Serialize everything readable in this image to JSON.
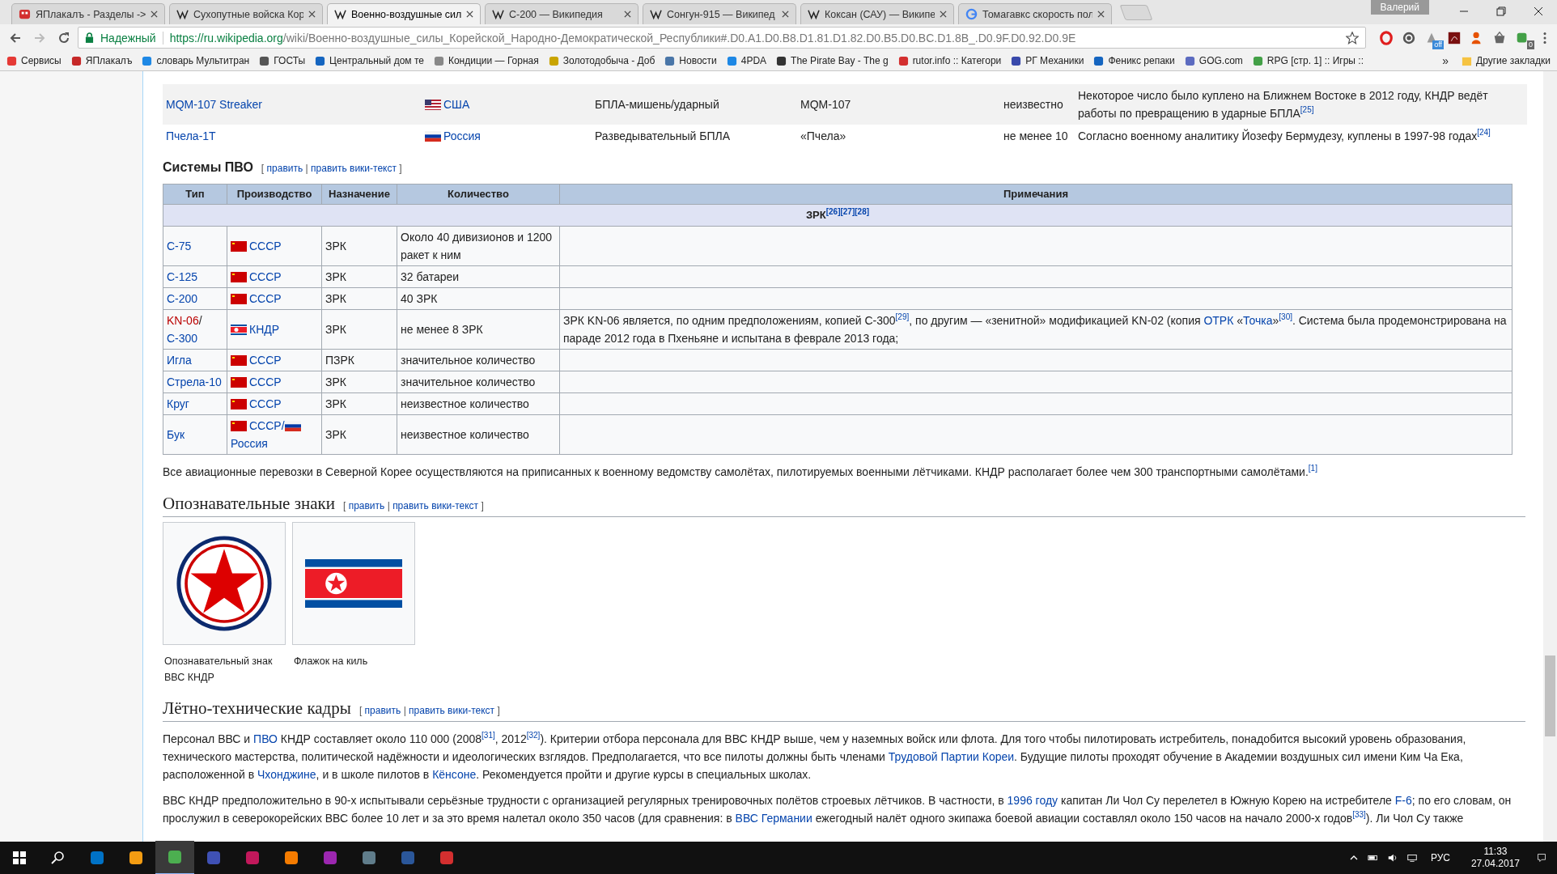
{
  "browser": {
    "tabs": [
      {
        "kind": "yaplakal",
        "title": "ЯПлакалъ - Разделы ->",
        "selected": false
      },
      {
        "kind": "wiki",
        "title": "Сухопутные войска Кор",
        "selected": false
      },
      {
        "kind": "wiki",
        "title": "Военно-воздушные сил",
        "selected": true
      },
      {
        "kind": "wiki",
        "title": "С-200 — Википедия",
        "selected": false
      },
      {
        "kind": "wiki",
        "title": "Сонгун-915 — Википед",
        "selected": false
      },
      {
        "kind": "wiki",
        "title": "Коксан (САУ) — Википе",
        "selected": false
      },
      {
        "kind": "google",
        "title": "Томагавкс скорость пол",
        "selected": false
      }
    ],
    "profile": "Валерий",
    "secure_label": "Надежный",
    "url_host": "https://ru.wikipedia.org",
    "url_path": "/wiki/Военно-воздушные_силы_Корейской_Народно-Демократической_Республики#.D0.A1.D0.B8.D1.81.D1.82.D0.B5.D0.BC.D1.8B_.D0.9F.D0.92.D0.9E",
    "extension_badges": [
      {
        "badge": "off"
      },
      {
        "badge": "0"
      }
    ],
    "bookmarks": [
      "Сервисы",
      "ЯПлакалъ",
      "словарь Мультитран",
      "ГОСТы",
      "Центральный дом те",
      "Кондиции — Горная",
      "Золотодобыча - Доб",
      "Новости",
      "4PDA",
      "The Pirate Bay - The g",
      "rutor.info :: Категори",
      "РГ Механики",
      "Феникс репаки",
      "GOG.com",
      "RPG [стр. 1] :: Игры ::"
    ],
    "bookmarks_overflow": "»",
    "other_bookmarks": "Другие закладки"
  },
  "prev_table": {
    "rows": [
      {
        "highlighted": true,
        "name": "MQM-107 Streaker",
        "origin": [
          {
            "kind": "usa-flag"
          },
          {
            "kind": "link",
            "text": "США"
          }
        ],
        "purpose": "БПЛА-мишень/ударный",
        "model": "MQM-107",
        "count": "неизвестно",
        "note": "Некоторое число было куплено на Ближнем Востоке в 2012 году, КНДР ведёт работы по превращению в ударные БПЛА$^{[25]}$"
      },
      {
        "highlighted": false,
        "name": "Пчела-1Т",
        "origin": [
          {
            "kind": "russia-flag"
          },
          {
            "kind": "link",
            "text": "Россия"
          }
        ],
        "purpose": "Разведывательный БПЛА",
        "model": "«Пчела»",
        "count": "не менее 10",
        "note": "Согласно военному аналитику Йозефу Бермудезу, куплены в 1997-98 годах$^{[24]}$"
      }
    ]
  },
  "pvo": {
    "heading": "Системы ПВО",
    "edit": {
      "open": "[",
      "links": [
        "править",
        "править вики-текст"
      ],
      "separator": "|",
      "close": "]"
    },
    "columns": [
      "Тип",
      "Производство",
      "Назначение",
      "Количество",
      "Примечания"
    ],
    "group": "ЗРК$^{[26][27][28]}$",
    "rows": [
      {
        "type": [
          {
            "kind": "link",
            "text": "С-75"
          }
        ],
        "origin": [
          {
            "kind": "ussr-flag"
          },
          {
            "kind": "link",
            "text": "СССР"
          }
        ],
        "purpose": "ЗРК",
        "count": "Около 40 дивизионов и 1200 ракет к ним",
        "note": []
      },
      {
        "type": [
          {
            "kind": "link",
            "text": "С-125"
          }
        ],
        "origin": [
          {
            "kind": "ussr-flag"
          },
          {
            "kind": "link",
            "text": "СССР"
          }
        ],
        "purpose": "ЗРК",
        "count": "32 батареи",
        "note": []
      },
      {
        "type": [
          {
            "kind": "link",
            "text": "С-200"
          }
        ],
        "origin": [
          {
            "kind": "ussr-flag"
          },
          {
            "kind": "link",
            "text": "СССР"
          }
        ],
        "purpose": "ЗРК",
        "count": "40 ЗРК",
        "note": []
      },
      {
        "type": [
          {
            "kind": "redlink",
            "text": "KN-06"
          },
          {
            "kind": "text",
            "text": "/"
          },
          {
            "kind": "link",
            "text": "С-300"
          }
        ],
        "origin": [
          {
            "kind": "dprk-flag"
          },
          {
            "kind": "link",
            "text": "КНДР"
          }
        ],
        "purpose": "ЗРК",
        "count": "не менее 8 ЗРК",
        "note": [
          {
            "kind": "text",
            "text": "ЗРК KN-06 является, по одним предположениям, копией С-300$^{[29]}$, по другим — «зенитной» модификацией KN-02 (копия "
          },
          {
            "kind": "link",
            "text": "ОТРК"
          },
          {
            "kind": "text",
            "text": " «"
          },
          {
            "kind": "link",
            "text": "Точка"
          },
          {
            "kind": "text",
            "text": "»$^{[30]}$. Система была продемонстрирована на параде 2012 года в Пхеньяне и испытана в феврале 2013 года;"
          }
        ]
      },
      {
        "type": [
          {
            "kind": "link",
            "text": "Игла"
          }
        ],
        "origin": [
          {
            "kind": "ussr-flag"
          },
          {
            "kind": "link",
            "text": "СССР"
          }
        ],
        "purpose": "ПЗРК",
        "count": "значительное количество",
        "note": []
      },
      {
        "type": [
          {
            "kind": "link",
            "text": "Стрела-10"
          }
        ],
        "origin": [
          {
            "kind": "ussr-flag"
          },
          {
            "kind": "link",
            "text": "СССР"
          }
        ],
        "purpose": "ЗРК",
        "count": "значительное количество",
        "note": []
      },
      {
        "type": [
          {
            "kind": "link",
            "text": "Круг"
          }
        ],
        "origin": [
          {
            "kind": "ussr-flag"
          },
          {
            "kind": "link",
            "text": "СССР"
          }
        ],
        "purpose": "ЗРК",
        "count": "неизвестное количество",
        "note": []
      },
      {
        "type": [
          {
            "kind": "link",
            "text": "Бук"
          }
        ],
        "origin": [
          {
            "kind": "ussr-flag"
          },
          {
            "kind": "link",
            "text": "СССР/"
          },
          {
            "kind": "russia-flag"
          },
          {
            "kind": "link",
            "text": "Россия"
          }
        ],
        "purpose": "ЗРК",
        "count": "неизвестное количество",
        "note": []
      }
    ]
  },
  "transport_paragraph": "Все авиационные перевозки в Северной Корее осуществляются на приписанных к военному ведомству самолётах, пилотируемых военными лётчиками. КНДР располагает более чем 300 транспортными самолётами.$^{[1]}$",
  "insignia": {
    "heading": "Опознавательные знаки",
    "edit": {
      "open": "[",
      "links": [
        "править",
        "править вики-текст"
      ],
      "separator": "|",
      "close": "]"
    },
    "gallery": [
      {
        "kind": "roundel",
        "caption": "Опознавательный знак ВВС КНДР"
      },
      {
        "kind": "flag",
        "caption": "Флажок на киль"
      }
    ]
  },
  "personnel": {
    "heading": "Лётно-технические кадры",
    "edit": {
      "open": "[",
      "links": [
        "править",
        "править вики-текст"
      ],
      "separator": "|",
      "close": "]"
    },
    "paragraphs": [
      [
        {
          "kind": "text",
          "text": "Персонал ВВС и "
        },
        {
          "kind": "link",
          "text": "ПВО"
        },
        {
          "kind": "text",
          "text": " КНДР составляет около 110 000 (2008$^{[31]}$, 2012$^{[32]}$). Критерии отбора персонала для ВВС КНДР выше, чем у наземных войск или флота. Для того чтобы пилотировать истребитель, понадобится высокий уровень образования, технического мастерства, политической надёжности и идеологических взглядов. Предполагается, что все пилоты должны быть членами "
        },
        {
          "kind": "link",
          "text": "Трудовой Партии Кореи"
        },
        {
          "kind": "text",
          "text": ". Будущие пилоты проходят обучение в Академии воздушных сил имени Ким Ча Ека, расположенной в "
        },
        {
          "kind": "link",
          "text": "Чхонджине"
        },
        {
          "kind": "text",
          "text": ", и в школе пилотов в "
        },
        {
          "kind": "link",
          "text": "Кёнсоне"
        },
        {
          "kind": "text",
          "text": ". Рекомендуется пройти и другие курсы в специальных школах."
        }
      ],
      [
        {
          "kind": "text",
          "text": "ВВС КНДР предположительно в 90-х испытывали серьёзные трудности с организацией регулярных тренировочных полётов строевых лётчиков. В частности, в "
        },
        {
          "kind": "link",
          "text": "1996 году"
        },
        {
          "kind": "text",
          "text": " капитан Ли Чол Су перелетел в Южную Корею на истребителе "
        },
        {
          "kind": "link",
          "text": "F-6"
        },
        {
          "kind": "text",
          "text": "; по его словам, он прослужил в северокорейских ВВС более 10 лет и за это время налетал около 350 часов (для сравнения: в "
        },
        {
          "kind": "link",
          "text": "ВВС Германии"
        },
        {
          "kind": "text",
          "text": " ежегодный налёт одного экипажа боевой авиации составлял около 150 часов на начало 2000-х годов$^{[33]}$). Ли Чол Су также"
        }
      ]
    ]
  },
  "taskbar": {
    "language": "РУС",
    "time": "11:33",
    "date": "27.04.2017"
  }
}
